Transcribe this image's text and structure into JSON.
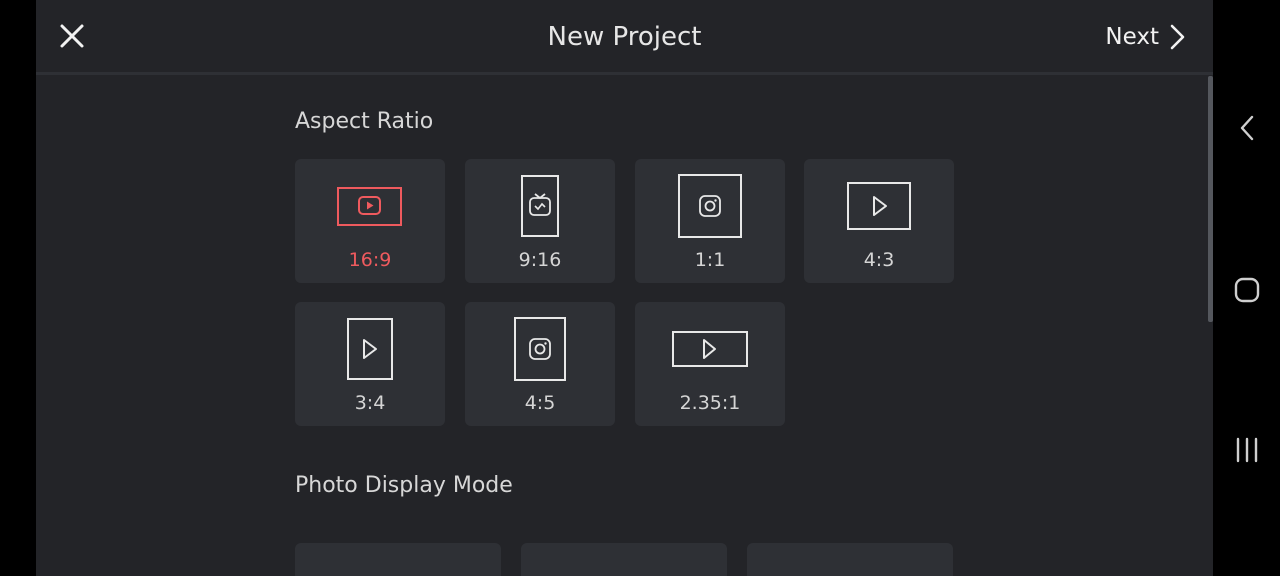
{
  "header": {
    "title": "New Project",
    "next_label": "Next"
  },
  "aspect_ratio": {
    "section_title": "Aspect Ratio",
    "selected": "16:9",
    "options": [
      {
        "label": "16:9",
        "icon": "youtube-icon"
      },
      {
        "label": "9:16",
        "icon": "igtv-icon"
      },
      {
        "label": "1:1",
        "icon": "instagram-icon"
      },
      {
        "label": "4:3",
        "icon": "play-icon"
      },
      {
        "label": "3:4",
        "icon": "play-icon"
      },
      {
        "label": "4:5",
        "icon": "instagram-icon"
      },
      {
        "label": "2.35:1",
        "icon": "play-icon"
      }
    ]
  },
  "photo_display_mode": {
    "section_title": "Photo Display Mode"
  },
  "nav_bar": {
    "buttons": [
      "back-icon",
      "home-icon",
      "recents-icon"
    ]
  },
  "colors": {
    "background": "#232428",
    "tile": "#2e3035",
    "accent": "#ef5a5e",
    "text": "#d5d5d5"
  }
}
